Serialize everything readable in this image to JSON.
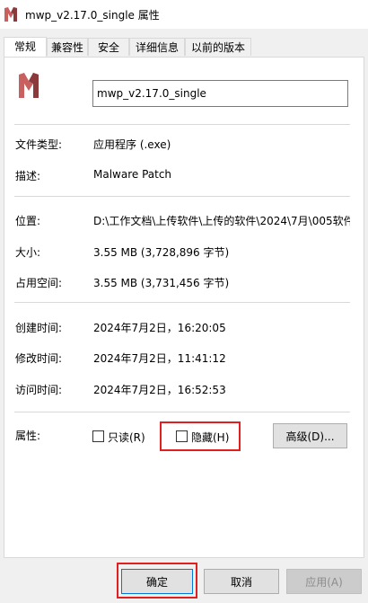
{
  "window": {
    "title": "mwp_v2.17.0_single 属性"
  },
  "tabs": [
    {
      "label": "常规"
    },
    {
      "label": "兼容性"
    },
    {
      "label": "安全"
    },
    {
      "label": "详细信息"
    },
    {
      "label": "以前的版本"
    }
  ],
  "file": {
    "name": "mwp_v2.17.0_single"
  },
  "details": {
    "type_label": "文件类型:",
    "type_value": "应用程序 (.exe)",
    "desc_label": "描述:",
    "desc_value": "Malware Patch",
    "location_label": "位置:",
    "location_value": "D:\\工作文档\\上传软件\\上传的软件\\2024\\7月\\005软件",
    "size_label": "大小:",
    "size_value": "3.55 MB (3,728,896 字节)",
    "disk_label": "占用空间:",
    "disk_value": "3.55 MB (3,731,456 字节)",
    "created_label": "创建时间:",
    "created_value": "2024年7月2日，16:20:05",
    "modified_label": "修改时间:",
    "modified_value": "2024年7月2日，11:41:12",
    "accessed_label": "访问时间:",
    "accessed_value": "2024年7月2日，16:52:53"
  },
  "attributes": {
    "label": "属性:",
    "readonly": "只读(R)",
    "hidden": "隐藏(H)",
    "advanced": "高级(D)..."
  },
  "buttons": {
    "ok": "确定",
    "cancel": "取消",
    "apply": "应用(A)"
  },
  "colors": {
    "highlight": "#e02020",
    "icon_accent": "#b84a4a"
  }
}
